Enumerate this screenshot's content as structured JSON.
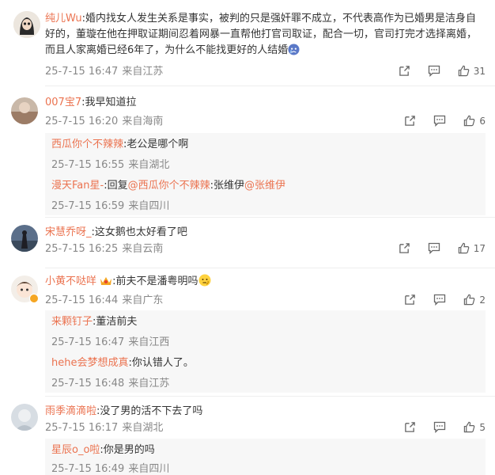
{
  "comments": [
    {
      "user": "纯儿Wu",
      "text": ":婚内找女人发生关系是事实，被判的只是强奸罪不成立，不代表高作为已婚男是洁身自好的，董璇在他在押取证期间忍着网暴一直帮他打官司取证，配合一切，官司打完才选择离婚，而且人家离婚已经6年了，为什么不能找更好的人结婚",
      "time": "25-7-15 16:47",
      "location": "来自江苏",
      "likes": "31",
      "emoji": "crying-face-icon"
    },
    {
      "user": "007宝7",
      "text": ":我早知道拉",
      "time": "25-7-15 16:20",
      "location": "来自海南",
      "likes": "6",
      "replies": [
        {
          "user": "西瓜你个不辣辣",
          "text": ":老公是哪个啊",
          "time": "25-7-15 16:55",
          "location": "来自湖北"
        },
        {
          "user": "漫天Fan星-",
          "reply_word": ":回复",
          "mention1": "@西瓜你个不辣辣",
          "mid": ":张维伊",
          "mention2": "@张维伊",
          "time": "25-7-15 16:59",
          "location": "来自四川"
        }
      ]
    },
    {
      "user": "宋慧乔呀_",
      "text": ":这女鹅也太好看了吧",
      "time": "25-7-15 16:25",
      "location": "来自云南",
      "likes": "17"
    },
    {
      "user": "小黄不哒咩",
      "text": ":前夫不是潘粤明吗",
      "time": "25-7-15 16:44",
      "location": "来自广东",
      "likes": "2",
      "badge": "crown-icon",
      "emoji": "thinking-face-icon",
      "replies": [
        {
          "user": "来颗钉子",
          "text": ":董洁前夫",
          "time": "25-7-15 16:47",
          "location": "来自江西"
        },
        {
          "user": "hehe会梦想成真",
          "text": ":你认错人了。",
          "time": "25-7-15 16:48",
          "location": "来自江苏"
        }
      ]
    },
    {
      "user": "雨季滴滴啦",
      "text": ":没了男的活不下去了吗",
      "time": "25-7-15 16:17",
      "location": "来自湖北",
      "likes": "5",
      "replies": [
        {
          "user": "星辰o_o啦",
          "text": ":你是男的吗",
          "time": "25-7-15 16:49",
          "location": "来自四川"
        }
      ]
    }
  ],
  "colors": {
    "username": "#eb7350",
    "meta": "#888888",
    "reply_bg": "#f7f7f7"
  }
}
